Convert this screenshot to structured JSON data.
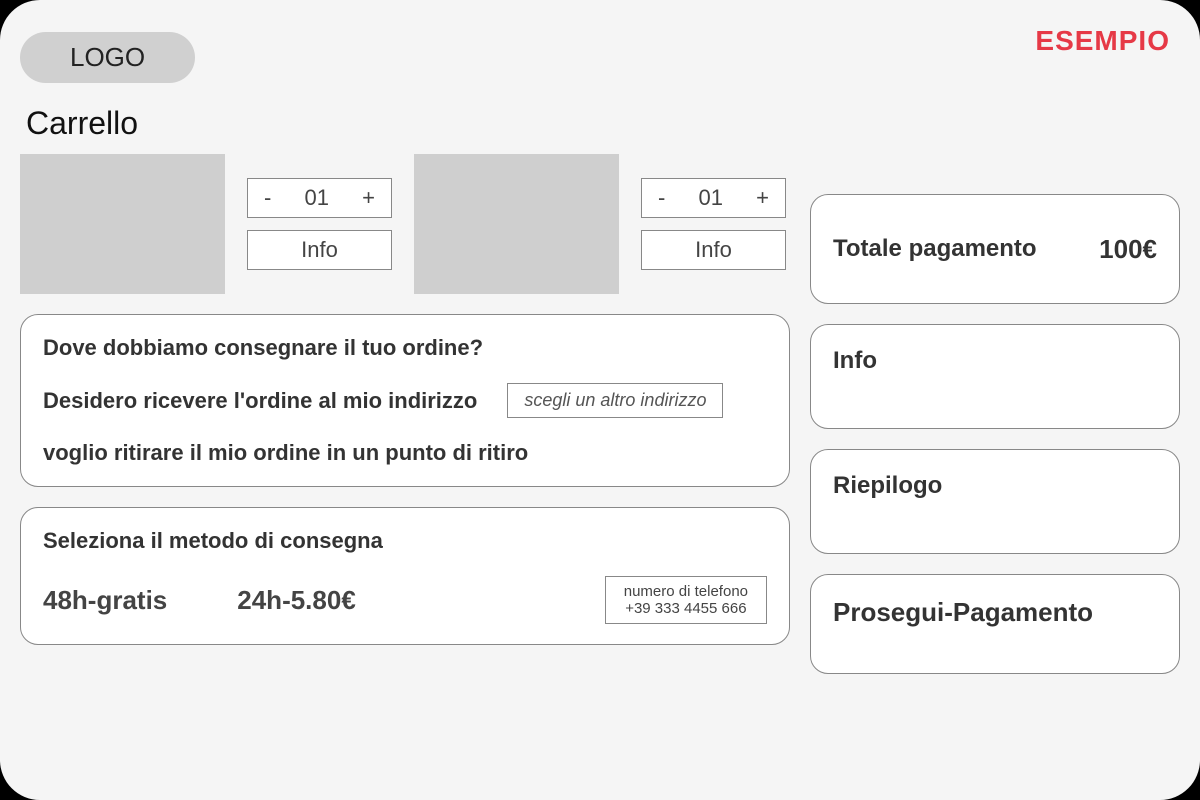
{
  "watermark": "ESEMPIO",
  "logo": "LOGO",
  "page_title": "Carrello",
  "cart_items": [
    {
      "qty": "01",
      "info_label": "Info"
    },
    {
      "qty": "01",
      "info_label": "Info"
    }
  ],
  "qty_minus": "-",
  "qty_plus": "+",
  "delivery": {
    "question": "Dove dobbiamo consegnare il tuo ordine?",
    "deliver_address_text": "Desidero ricevere l'ordine al mio indirizzo",
    "choose_another": "scegli un altro indirizzo",
    "pickup_text": "voglio ritirare il mio ordine in un punto di ritiro"
  },
  "shipping": {
    "question": "Seleziona il metodo di consegna",
    "option_48h": "48h-gratis",
    "option_24h": "24h-5.80€",
    "phone_label": "numero di telefono",
    "phone_number": "+39 333 4455 666"
  },
  "sidebar": {
    "total_label": "Totale pagamento",
    "total_amount": "100€",
    "info_label": "Info",
    "summary_label": "Riepilogo",
    "proceed_label": "Prosegui-Pagamento"
  }
}
